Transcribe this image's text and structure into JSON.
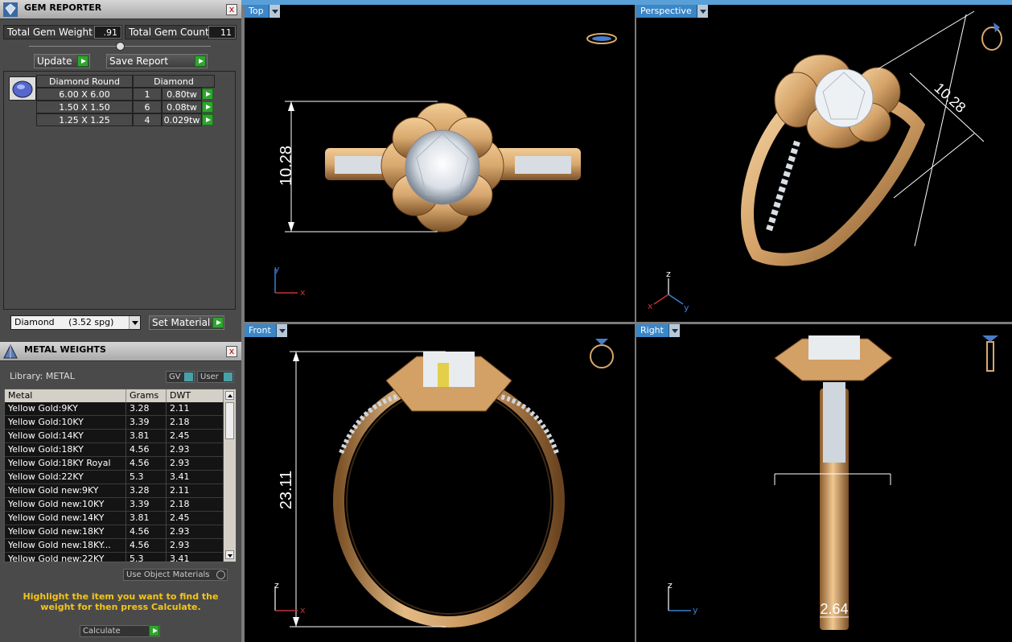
{
  "gem_reporter": {
    "title": "GEM REPORTER",
    "close": "x",
    "total_weight_label": "Total Gem Weight",
    "total_weight_value": ".91",
    "total_count_label": "Total Gem Count",
    "total_count_value": "11",
    "update_label": "Update",
    "save_report_label": "Save Report",
    "columns": [
      "Diamond Round",
      "Diamond"
    ],
    "rows": [
      {
        "size": "6.00 X 6.00",
        "count": "1",
        "weight": "0.80tw"
      },
      {
        "size": "1.50 X 1.50",
        "count": "6",
        "weight": "0.08tw"
      },
      {
        "size": "1.25 X 1.25",
        "count": "4",
        "weight": "0.029tw"
      }
    ],
    "material_select": "Diamond     (3.52 spg)",
    "set_material_label": "Set Material"
  },
  "metal_weights": {
    "title": "METAL WEIGHTS",
    "close": "x",
    "library_label": "Library: METAL",
    "gv_label": "GV",
    "user_label": "User",
    "columns": [
      "Metal",
      "Grams",
      "DWT"
    ],
    "rows": [
      {
        "metal": "Yellow Gold:9KY",
        "grams": "3.28",
        "dwt": "2.11"
      },
      {
        "metal": "Yellow Gold:10KY",
        "grams": "3.39",
        "dwt": "2.18"
      },
      {
        "metal": "Yellow Gold:14KY",
        "grams": "3.81",
        "dwt": "2.45"
      },
      {
        "metal": "Yellow Gold:18KY",
        "grams": "4.56",
        "dwt": "2.93"
      },
      {
        "metal": "Yellow Gold:18KY Royal",
        "grams": "4.56",
        "dwt": "2.93"
      },
      {
        "metal": "Yellow Gold:22KY",
        "grams": "5.3",
        "dwt": "3.41"
      },
      {
        "metal": "Yellow Gold new:9KY",
        "grams": "3.28",
        "dwt": "2.11"
      },
      {
        "metal": "Yellow Gold new:10KY",
        "grams": "3.39",
        "dwt": "2.18"
      },
      {
        "metal": "Yellow Gold new:14KY",
        "grams": "3.81",
        "dwt": "2.45"
      },
      {
        "metal": "Yellow Gold new:18KY",
        "grams": "4.56",
        "dwt": "2.93"
      },
      {
        "metal": "Yellow Gold new:18KY...",
        "grams": "4.56",
        "dwt": "2.93"
      },
      {
        "metal": "Yellow Gold new:22KY",
        "grams": "5.3",
        "dwt": "3.41"
      }
    ],
    "use_object_materials": "Use Object Materials",
    "hint": "Highlight the item you want to find the weight for then press Calculate.",
    "calculate_label": "Calculate"
  },
  "viewports": {
    "top": {
      "label": "Top",
      "dimension": "10.28",
      "axis_a": "y",
      "axis_b": "x"
    },
    "perspective": {
      "label": "Perspective",
      "dimension": "10.28",
      "axis_a": "z",
      "axis_b": "x",
      "axis_c": "y"
    },
    "front": {
      "label": "Front",
      "dimension": "23.11",
      "axis_a": "z",
      "axis_b": "x"
    },
    "right": {
      "label": "Right",
      "dimension": "2.64",
      "axis_a": "z",
      "axis_b": "y"
    }
  },
  "colors": {
    "gold": "#d8a86e",
    "gold_dark": "#8a5a2c",
    "viewport_label": "#3b86c7",
    "panel_bg": "#4a4a4a",
    "hint": "#f5c518"
  }
}
